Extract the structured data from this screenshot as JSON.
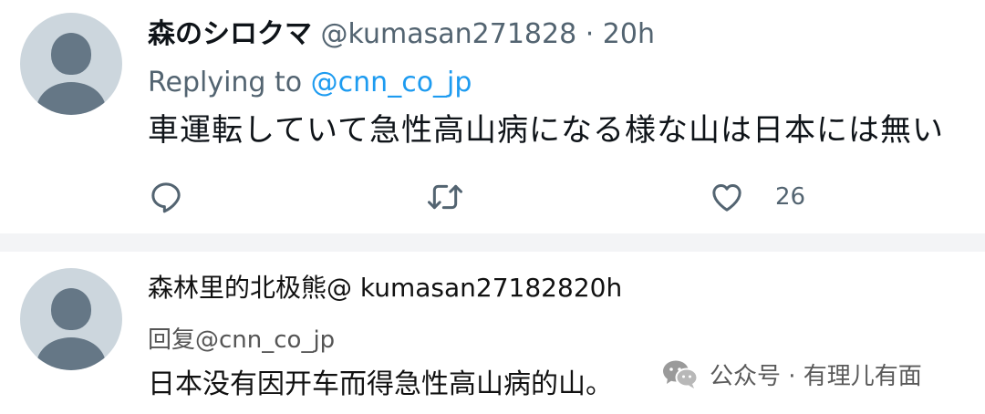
{
  "tweet1": {
    "display_name": "森のシロクマ",
    "handle_time": "@kumasan271828 · 20h",
    "replying_prefix": "Replying to ",
    "replying_mention": "@cnn_co_jp",
    "text": "車運転していて急性高山病になる様な山は日本には無い",
    "like_count": "26"
  },
  "tweet2": {
    "header": "森林里的北极熊@ kumasan27182820h",
    "replying": "回复@cnn_co_jp",
    "text": "日本没有因开车而得急性高山病的山。"
  },
  "watermark": {
    "text": "公众号 · 有理儿有面",
    "icon": "wechat-icon"
  },
  "colors": {
    "mention": "#1d9bf0",
    "secondary_text": "#536471",
    "avatar_bg": "#ccd6dd",
    "avatar_fg": "#657786"
  }
}
